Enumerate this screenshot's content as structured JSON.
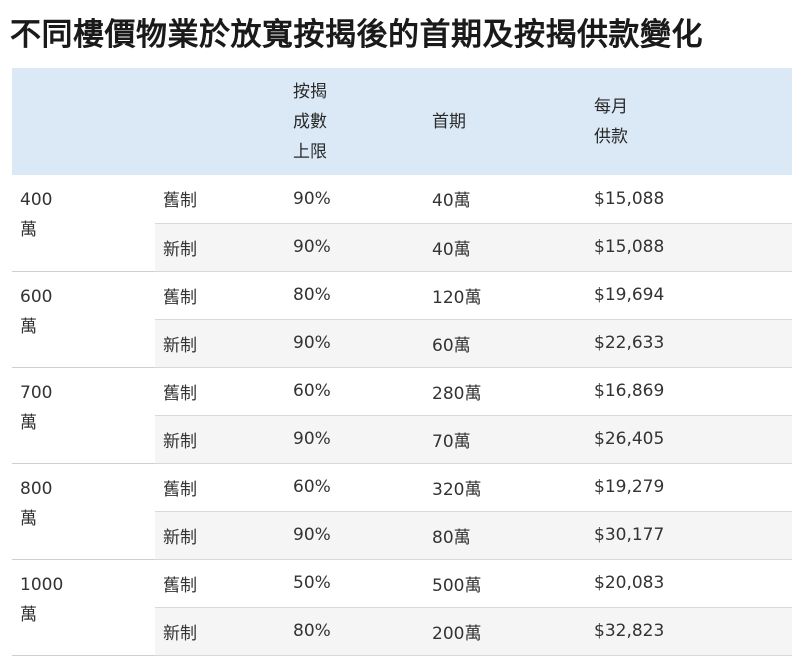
{
  "title": "不同樓價物業於放寬按揭後的首期及按揭供款變化",
  "table": {
    "headers": {
      "price": "",
      "scheme": "",
      "ltv": [
        "按揭",
        "成數",
        "上限"
      ],
      "down_payment": "首期",
      "monthly": [
        "每月",
        "供款"
      ]
    },
    "groups": [
      {
        "price": [
          "400",
          "萬"
        ],
        "rows": [
          {
            "scheme": "舊制",
            "ltv": "90%",
            "down": "40萬",
            "monthly": "$15,088"
          },
          {
            "scheme": "新制",
            "ltv": "90%",
            "down": "40萬",
            "monthly": "$15,088"
          }
        ]
      },
      {
        "price": [
          "600",
          "萬"
        ],
        "rows": [
          {
            "scheme": "舊制",
            "ltv": "80%",
            "down": "120萬",
            "monthly": "$19,694"
          },
          {
            "scheme": "新制",
            "ltv": "90%",
            "down": "60萬",
            "monthly": "$22,633"
          }
        ]
      },
      {
        "price": [
          "700",
          "萬"
        ],
        "rows": [
          {
            "scheme": "舊制",
            "ltv": "60%",
            "down": "280萬",
            "monthly": "$16,869"
          },
          {
            "scheme": "新制",
            "ltv": "90%",
            "down": "70萬",
            "monthly": "$26,405"
          }
        ]
      },
      {
        "price": [
          "800",
          "萬"
        ],
        "rows": [
          {
            "scheme": "舊制",
            "ltv": "60%",
            "down": "320萬",
            "monthly": "$19,279"
          },
          {
            "scheme": "新制",
            "ltv": "90%",
            "down": "80萬",
            "monthly": "$30,177"
          }
        ]
      },
      {
        "price": [
          "1000",
          "萬"
        ],
        "rows": [
          {
            "scheme": "舊制",
            "ltv": "50%",
            "down": "500萬",
            "monthly": "$20,083"
          },
          {
            "scheme": "新制",
            "ltv": "80%",
            "down": "200萬",
            "monthly": "$32,823"
          }
        ]
      }
    ]
  },
  "colors": {
    "header_bg": "#dbe9f6",
    "alt_row_bg": "#f5f5f5",
    "border": "#d9d9d9"
  }
}
